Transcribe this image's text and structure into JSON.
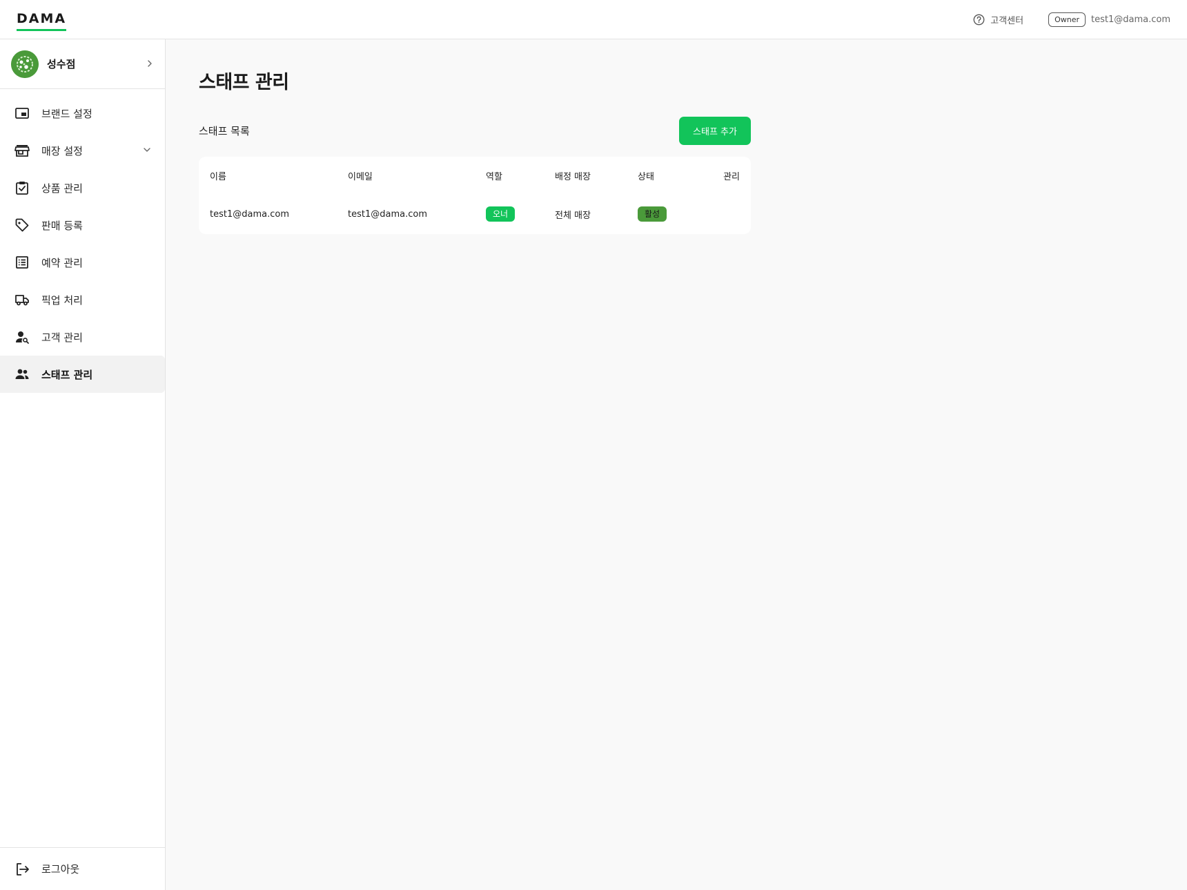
{
  "app": {
    "logo": "DAMA"
  },
  "topbar": {
    "help_label": "고객센터",
    "role": "Owner",
    "email": "test1@dama.com"
  },
  "sidebar": {
    "store_name": "성수점",
    "items": [
      {
        "label": "브랜드 설정",
        "icon": "brand-card-icon"
      },
      {
        "label": "매장 설정",
        "icon": "storefront-icon"
      },
      {
        "label": "상품 관리",
        "icon": "clipboard-check-icon"
      },
      {
        "label": "판매 등록",
        "icon": "tag-icon"
      },
      {
        "label": "예약 관리",
        "icon": "list-icon"
      },
      {
        "label": "픽업 처리",
        "icon": "truck-icon"
      },
      {
        "label": "고객 관리",
        "icon": "person-search-icon"
      },
      {
        "label": "스태프 관리",
        "icon": "people-icon"
      }
    ],
    "active_index": 7,
    "logout_label": "로그아웃"
  },
  "main": {
    "title": "스태프 관리",
    "section_title": "스태프 목록",
    "add_button": "스태프 추가",
    "table": {
      "headers": [
        "이름",
        "이메일",
        "역할",
        "배정 매장",
        "상태",
        "관리"
      ],
      "rows": [
        {
          "name": "test1@dama.com",
          "email": "test1@dama.com",
          "role": "오너",
          "store": "전체 매장",
          "status": "활성",
          "actions": ""
        }
      ]
    }
  },
  "colors": {
    "accent": "#12c45a",
    "role_badge": "#12c45a",
    "status_badge": "#4a9a3a"
  }
}
